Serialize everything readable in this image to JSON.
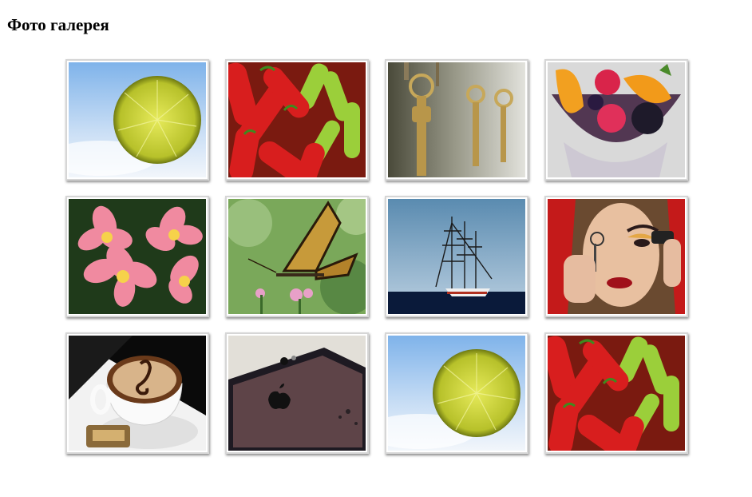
{
  "page": {
    "title": "Фото галерея"
  },
  "gallery": {
    "photos": [
      {
        "subject": "lime-slice-sky"
      },
      {
        "subject": "chili-peppers"
      },
      {
        "subject": "keys"
      },
      {
        "subject": "fruit-bowl"
      },
      {
        "subject": "plumeria-flowers"
      },
      {
        "subject": "butterfly"
      },
      {
        "subject": "sailing-ship"
      },
      {
        "subject": "makeup-woman"
      },
      {
        "subject": "latte-art"
      },
      {
        "subject": "iphone"
      },
      {
        "subject": "lime-slice-sky"
      },
      {
        "subject": "chili-peppers"
      }
    ]
  }
}
